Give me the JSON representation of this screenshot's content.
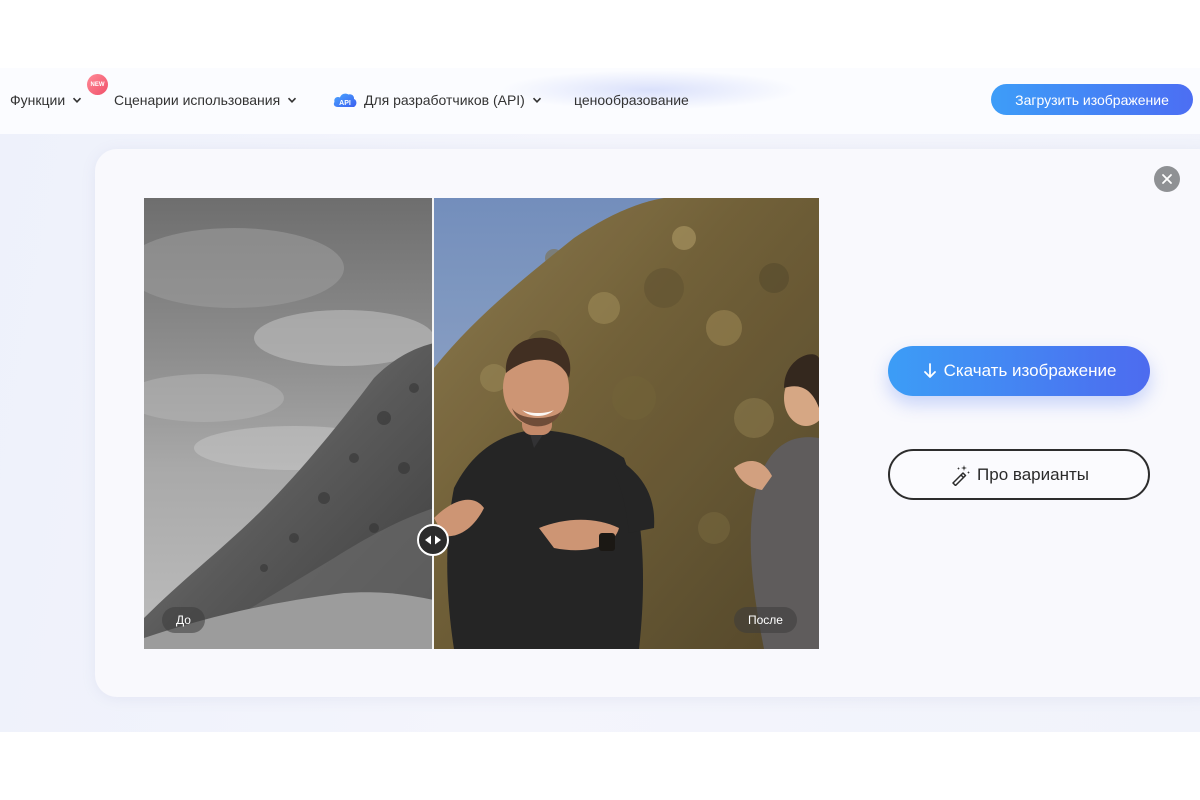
{
  "nav": {
    "features_label": "Функции",
    "new_badge": "NEW",
    "use_cases_label": "Сценарии использования",
    "api_badge": "API",
    "developers_label": "Для разработчиков (API)",
    "pricing_label": "ценообразование",
    "upload_label": "Загрузить изображение"
  },
  "editor": {
    "before_label": "До",
    "after_label": "После",
    "download_label": "Скачать изображение",
    "variants_label": "Про варианты"
  },
  "colors": {
    "accent_start": "#3d9df8",
    "accent_end": "#4c6ef3",
    "new_badge": "#f0506a"
  },
  "icons": {
    "close": "close-icon",
    "handle": "compare-slider-icon",
    "download": "download-arrow-icon",
    "variants": "magic-wand-icon",
    "chevron": "chevron-down-icon"
  }
}
